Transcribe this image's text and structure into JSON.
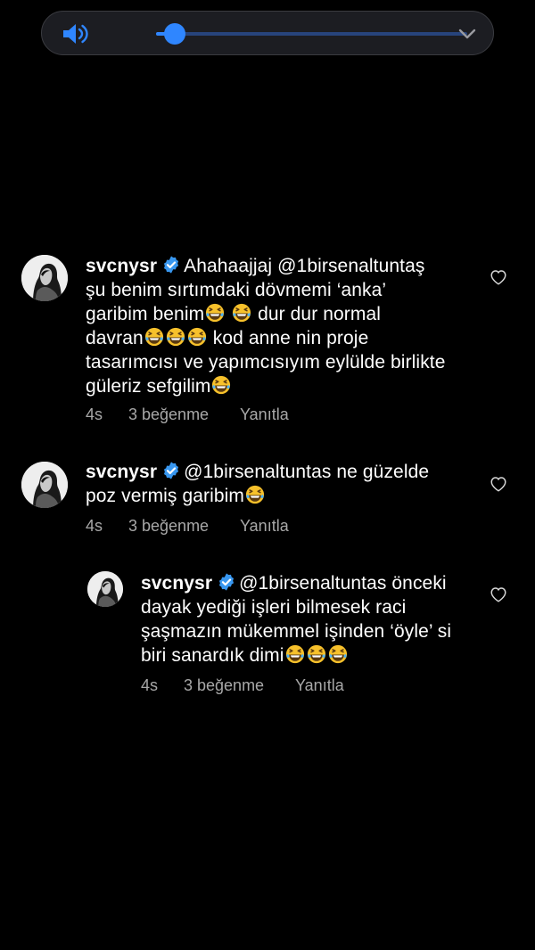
{
  "volume": {
    "level_percent": 6,
    "icon": "speaker-icon",
    "expand_icon": "chevron-down-icon",
    "accent": "#2f86ff"
  },
  "comments": [
    {
      "username": "svcnysr",
      "text_parts": [
        "Ahahaajjaj @1birsenaltuntaş",
        "şu benim sırtımdaki dövmemi ‘anka’",
        "garibim benim",
        "dur dur normal",
        "davran",
        "kod anne nin proje",
        "tasarımcısı ve yapımcısıyım eylülde birlikte",
        "güleriz sefgilim"
      ],
      "time": "4s",
      "likes": "3 beğenme",
      "reply": "Yanıtla"
    },
    {
      "username": "svcnysr",
      "text_parts": [
        "@1birsenaltuntas  ne güzelde",
        "poz vermiş garibim"
      ],
      "time": "4s",
      "likes": "3 beğenme",
      "reply": "Yanıtla"
    },
    {
      "username": "svcnysr",
      "text_parts": [
        "@1birsenaltuntas  önceki",
        "dayak yediği işleri bilmesek raci",
        "şaşmazın mükemmel işinden ‘öyle’ si",
        "biri sanardık dimi"
      ],
      "time": "4s",
      "likes": "3 beğenme",
      "reply": "Yanıtla"
    }
  ],
  "colors": {
    "background": "#000000",
    "text": "#ffffff",
    "meta": "#a8a8a8",
    "verified": "#3897f0",
    "emoji": "#f7c12b"
  }
}
